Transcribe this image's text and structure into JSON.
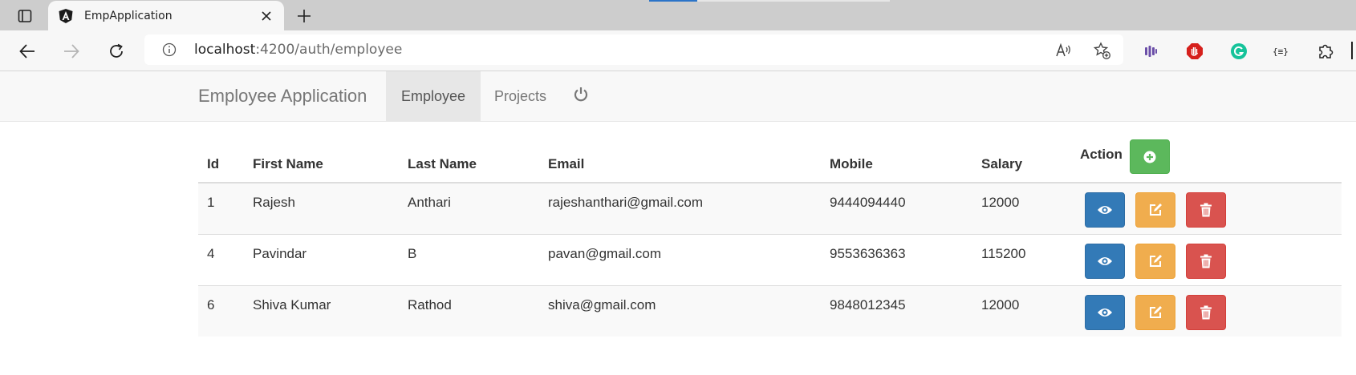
{
  "browser": {
    "tab_title": "EmpApplication",
    "url_host": "localhost",
    "url_rest": ":4200/auth/employee"
  },
  "app": {
    "brand": "Employee Application",
    "nav": [
      {
        "label": "Employee",
        "active": true
      },
      {
        "label": "Projects",
        "active": false
      }
    ]
  },
  "table": {
    "headers": [
      "Id",
      "First Name",
      "Last Name",
      "Email",
      "Mobile",
      "Salary",
      "Action"
    ],
    "rows": [
      {
        "id": "1",
        "first_name": "Rajesh",
        "last_name": "Anthari",
        "email": "rajeshanthari@gmail.com",
        "mobile": "9444094440",
        "salary": "12000"
      },
      {
        "id": "4",
        "first_name": "Pavindar",
        "last_name": "B",
        "email": "pavan@gmail.com",
        "mobile": "9553636363",
        "salary": "115200"
      },
      {
        "id": "6",
        "first_name": "Shiva Kumar",
        "last_name": "Rathod",
        "email": "shiva@gmail.com",
        "mobile": "9848012345",
        "salary": "12000"
      }
    ]
  },
  "icons": {
    "add": "plus-circle-icon",
    "view": "eye-icon",
    "edit": "edit-icon",
    "delete": "trash-icon",
    "logout": "power-icon"
  },
  "colors": {
    "add": "#5cb85c",
    "view": "#337ab7",
    "edit": "#f0ad4e",
    "delete": "#d9534f"
  }
}
